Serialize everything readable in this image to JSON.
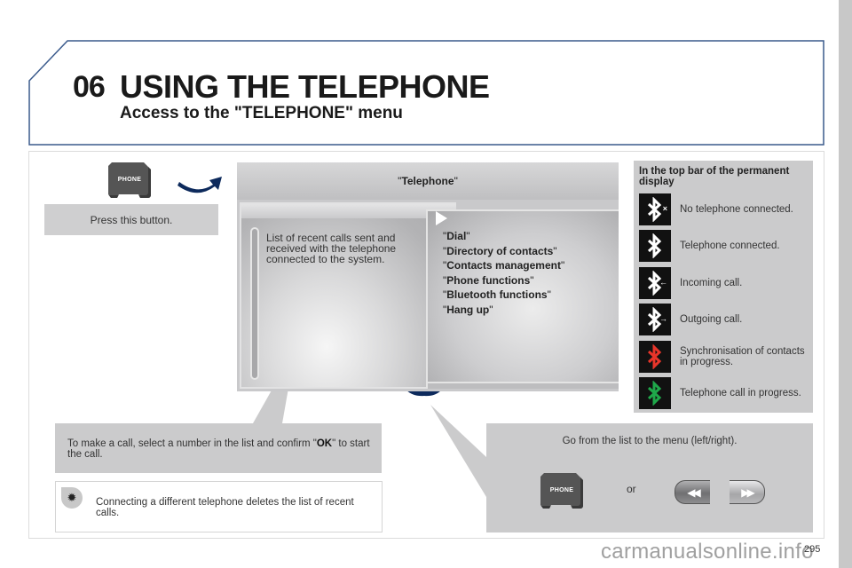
{
  "header": {
    "chapter_number": "06",
    "title": "USING THE TELEPHONE",
    "subtitle": "Access to the \"TELEPHONE\" menu"
  },
  "phone_button": {
    "label": "PHONE",
    "caption": "Press this button."
  },
  "screen": {
    "title": "Telephone",
    "list_description": "List of recent calls sent and received with the telephone connected to the system.",
    "menu_items": [
      "Dial",
      "Directory of contacts",
      "Contacts management",
      "Phone functions",
      "Bluetooth functions",
      "Hang up"
    ]
  },
  "status_panel": {
    "title": "In the top bar of the permanent display",
    "items": [
      {
        "icon": "bluetooth-disconnected-icon",
        "label": "No telephone connected.",
        "color": "#ffffff",
        "badge": "×"
      },
      {
        "icon": "bluetooth-connected-icon",
        "label": "Telephone connected.",
        "color": "#ffffff",
        "badge": ""
      },
      {
        "icon": "bluetooth-incoming-icon",
        "label": "Incoming call.",
        "color": "#ffffff",
        "badge": "←"
      },
      {
        "icon": "bluetooth-outgoing-icon",
        "label": "Outgoing call.",
        "color": "#ffffff",
        "badge": "→"
      },
      {
        "icon": "bluetooth-sync-icon",
        "label": "Synchronisation of contacts in progress.",
        "color": "#e8352a",
        "badge": ""
      },
      {
        "icon": "bluetooth-call-icon",
        "label": "Telephone call in progress.",
        "color": "#1fa84a",
        "badge": ""
      }
    ]
  },
  "callouts": {
    "make_call_prefix": "To make a call, select a number in the list and confirm \"",
    "make_call_bold": "OK",
    "make_call_suffix": "\" to start the call.",
    "navigate": "Go from the list to the menu (left/right).",
    "or": "or",
    "seek_back_glyph": "◀◀",
    "seek_forward_glyph": "▶▶"
  },
  "tip": {
    "icon": "lightbulb-icon",
    "glyph": "✹",
    "text": "Connecting a different telephone deletes the list of recent calls."
  },
  "footer": {
    "page_number": "295",
    "watermark": "carmanualsonline.info"
  },
  "colors": {
    "accent_arrow": "#0d2a5c",
    "header_border": "#3a5a8c",
    "panel_gray": "#cbcbcc"
  }
}
